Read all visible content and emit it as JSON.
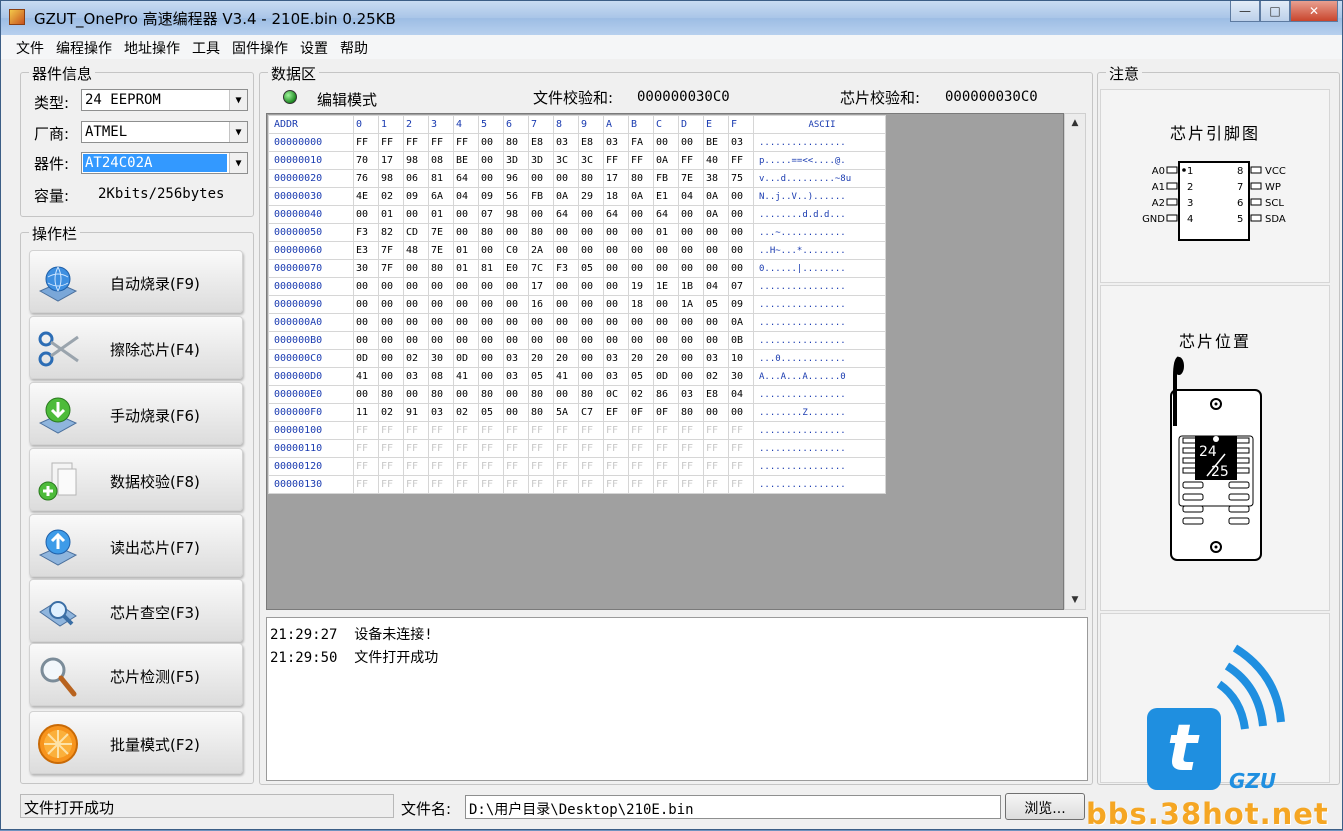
{
  "window": {
    "title": "GZUT_OnePro 高速编程器 V3.4 - 210E.bin  0.25KB",
    "minimize": "—",
    "maximize": "□",
    "close": "✕"
  },
  "menu": [
    "文件",
    "编程操作",
    "地址操作",
    "工具",
    "固件操作",
    "设置",
    "帮助"
  ],
  "device_info": {
    "title": "器件信息",
    "type_label": "类型:",
    "type_value": "24 EEPROM",
    "vendor_label": "厂商:",
    "vendor_value": "ATMEL",
    "device_label": "器件:",
    "device_value": "AT24C02A",
    "capacity_label": "容量:",
    "capacity_value": "2Kbits/256bytes"
  },
  "operations": {
    "title": "操作栏",
    "buttons": [
      {
        "label": "自动烧录(F9)",
        "icon": "globe-book-icon"
      },
      {
        "label": "擦除芯片(F4)",
        "icon": "scissors-icon"
      },
      {
        "label": "手动烧录(F6)",
        "icon": "download-arrow-icon"
      },
      {
        "label": "数据校验(F8)",
        "icon": "add-document-icon"
      },
      {
        "label": "读出芯片(F7)",
        "icon": "upload-arrow-icon"
      },
      {
        "label": "芯片查空(F3)",
        "icon": "magnifier-book-icon"
      },
      {
        "label": "芯片检测(F5)",
        "icon": "magnifier-icon"
      },
      {
        "label": "批量模式(F2)",
        "icon": "orange-icon"
      }
    ]
  },
  "data_area": {
    "title": "数据区",
    "mode": "编辑模式",
    "file_checksum_label": "文件校验和:",
    "file_checksum": "000000030C0",
    "chip_checksum_label": "芯片校验和:",
    "chip_checksum": "000000030C0",
    "columns": [
      "ADDR",
      "0",
      "1",
      "2",
      "3",
      "4",
      "5",
      "6",
      "7",
      "8",
      "9",
      "A",
      "B",
      "C",
      "D",
      "E",
      "F",
      "ASCII"
    ],
    "rows": [
      {
        "addr": "00000000",
        "bytes": [
          "FF",
          "FF",
          "FF",
          "FF",
          "FF",
          "00",
          "80",
          "E8",
          "03",
          "E8",
          "03",
          "FA",
          "00",
          "00",
          "BE",
          "03"
        ],
        "ascii": "................"
      },
      {
        "addr": "00000010",
        "bytes": [
          "70",
          "17",
          "98",
          "08",
          "BE",
          "00",
          "3D",
          "3D",
          "3C",
          "3C",
          "FF",
          "FF",
          "0A",
          "FF",
          "40",
          "FF"
        ],
        "ascii": "p.....==<<....@."
      },
      {
        "addr": "00000020",
        "bytes": [
          "76",
          "98",
          "06",
          "81",
          "64",
          "00",
          "96",
          "00",
          "00",
          "80",
          "17",
          "80",
          "FB",
          "7E",
          "38",
          "75"
        ],
        "ascii": "v...d.........~8u"
      },
      {
        "addr": "00000030",
        "bytes": [
          "4E",
          "02",
          "09",
          "6A",
          "04",
          "09",
          "56",
          "FB",
          "0A",
          "29",
          "18",
          "0A",
          "E1",
          "04",
          "0A",
          "00"
        ],
        "ascii": "N..j..V..)......"
      },
      {
        "addr": "00000040",
        "bytes": [
          "00",
          "01",
          "00",
          "01",
          "00",
          "07",
          "98",
          "00",
          "64",
          "00",
          "64",
          "00",
          "64",
          "00",
          "0A",
          "00"
        ],
        "ascii": "........d.d.d..."
      },
      {
        "addr": "00000050",
        "bytes": [
          "F3",
          "82",
          "CD",
          "7E",
          "00",
          "80",
          "00",
          "80",
          "00",
          "00",
          "00",
          "00",
          "01",
          "00",
          "00",
          "00"
        ],
        "ascii": "...~............"
      },
      {
        "addr": "00000060",
        "bytes": [
          "E3",
          "7F",
          "48",
          "7E",
          "01",
          "00",
          "C0",
          "2A",
          "00",
          "00",
          "00",
          "00",
          "00",
          "00",
          "00",
          "00"
        ],
        "ascii": "..H~...*........"
      },
      {
        "addr": "00000070",
        "bytes": [
          "30",
          "7F",
          "00",
          "80",
          "01",
          "81",
          "E0",
          "7C",
          "F3",
          "05",
          "00",
          "00",
          "00",
          "00",
          "00",
          "00"
        ],
        "ascii": "0......|........"
      },
      {
        "addr": "00000080",
        "bytes": [
          "00",
          "00",
          "00",
          "00",
          "00",
          "00",
          "00",
          "17",
          "00",
          "00",
          "00",
          "19",
          "1E",
          "1B",
          "04",
          "07"
        ],
        "ascii": "................"
      },
      {
        "addr": "00000090",
        "bytes": [
          "00",
          "00",
          "00",
          "00",
          "00",
          "00",
          "00",
          "16",
          "00",
          "00",
          "00",
          "18",
          "00",
          "1A",
          "05",
          "09"
        ],
        "ascii": "................"
      },
      {
        "addr": "000000A0",
        "bytes": [
          "00",
          "00",
          "00",
          "00",
          "00",
          "00",
          "00",
          "00",
          "00",
          "00",
          "00",
          "00",
          "00",
          "00",
          "00",
          "0A"
        ],
        "ascii": "................"
      },
      {
        "addr": "000000B0",
        "bytes": [
          "00",
          "00",
          "00",
          "00",
          "00",
          "00",
          "00",
          "00",
          "00",
          "00",
          "00",
          "00",
          "00",
          "00",
          "00",
          "0B"
        ],
        "ascii": "................"
      },
      {
        "addr": "000000C0",
        "bytes": [
          "0D",
          "00",
          "02",
          "30",
          "0D",
          "00",
          "03",
          "20",
          "20",
          "00",
          "03",
          "20",
          "20",
          "00",
          "03",
          "10"
        ],
        "ascii": "...0............"
      },
      {
        "addr": "000000D0",
        "bytes": [
          "41",
          "00",
          "03",
          "08",
          "41",
          "00",
          "03",
          "05",
          "41",
          "00",
          "03",
          "05",
          "0D",
          "00",
          "02",
          "30"
        ],
        "ascii": "A...A...A......0"
      },
      {
        "addr": "000000E0",
        "bytes": [
          "00",
          "80",
          "00",
          "80",
          "00",
          "80",
          "00",
          "80",
          "00",
          "80",
          "0C",
          "02",
          "86",
          "03",
          "E8",
          "04"
        ],
        "ascii": "................"
      },
      {
        "addr": "000000F0",
        "bytes": [
          "11",
          "02",
          "91",
          "03",
          "02",
          "05",
          "00",
          "80",
          "5A",
          "C7",
          "EF",
          "0F",
          "0F",
          "80",
          "00",
          "00"
        ],
        "ascii": "........Z......."
      },
      {
        "addr": "00000100",
        "bytes": [
          "FF",
          "FF",
          "FF",
          "FF",
          "FF",
          "FF",
          "FF",
          "FF",
          "FF",
          "FF",
          "FF",
          "FF",
          "FF",
          "FF",
          "FF",
          "FF"
        ],
        "ascii": "................"
      },
      {
        "addr": "00000110",
        "bytes": [
          "FF",
          "FF",
          "FF",
          "FF",
          "FF",
          "FF",
          "FF",
          "FF",
          "FF",
          "FF",
          "FF",
          "FF",
          "FF",
          "FF",
          "FF",
          "FF"
        ],
        "ascii": "................"
      },
      {
        "addr": "00000120",
        "bytes": [
          "FF",
          "FF",
          "FF",
          "FF",
          "FF",
          "FF",
          "FF",
          "FF",
          "FF",
          "FF",
          "FF",
          "FF",
          "FF",
          "FF",
          "FF",
          "FF"
        ],
        "ascii": "................"
      },
      {
        "addr": "00000130",
        "bytes": [
          "FF",
          "FF",
          "FF",
          "FF",
          "FF",
          "FF",
          "FF",
          "FF",
          "FF",
          "FF",
          "FF",
          "FF",
          "FF",
          "FF",
          "FF",
          "FF"
        ],
        "ascii": "................"
      }
    ]
  },
  "log": [
    {
      "time": "21:29:27",
      "message": "设备未连接!"
    },
    {
      "time": "21:29:50",
      "message": "文件打开成功"
    }
  ],
  "notes": {
    "title": "注意",
    "pinout_title": "芯片引脚图",
    "pins_left": [
      "A0",
      "A1",
      "A2",
      "GND"
    ],
    "pins_left_num": [
      "1",
      "2",
      "3",
      "4"
    ],
    "pins_right": [
      "VCC",
      "WP",
      "SCL",
      "SDA"
    ],
    "pins_right_num": [
      "8",
      "7",
      "6",
      "5"
    ],
    "position_title": "芯片位置",
    "socket_label_top": "24",
    "socket_label_bottom": "25",
    "logo_text": "GZU",
    "logo_letter": "t"
  },
  "bottom": {
    "status": "文件打开成功",
    "filename_label": "文件名:",
    "filename_value": "D:\\用户目录\\Desktop\\210E.bin",
    "browse": "浏览...",
    "watermark": "bbs.38hot.net"
  },
  "colors": {
    "accent_blue": "#1a3bb0",
    "selection": "#3399ff",
    "led_green": "#1f8a23",
    "logo_blue": "#1f8fe0"
  }
}
